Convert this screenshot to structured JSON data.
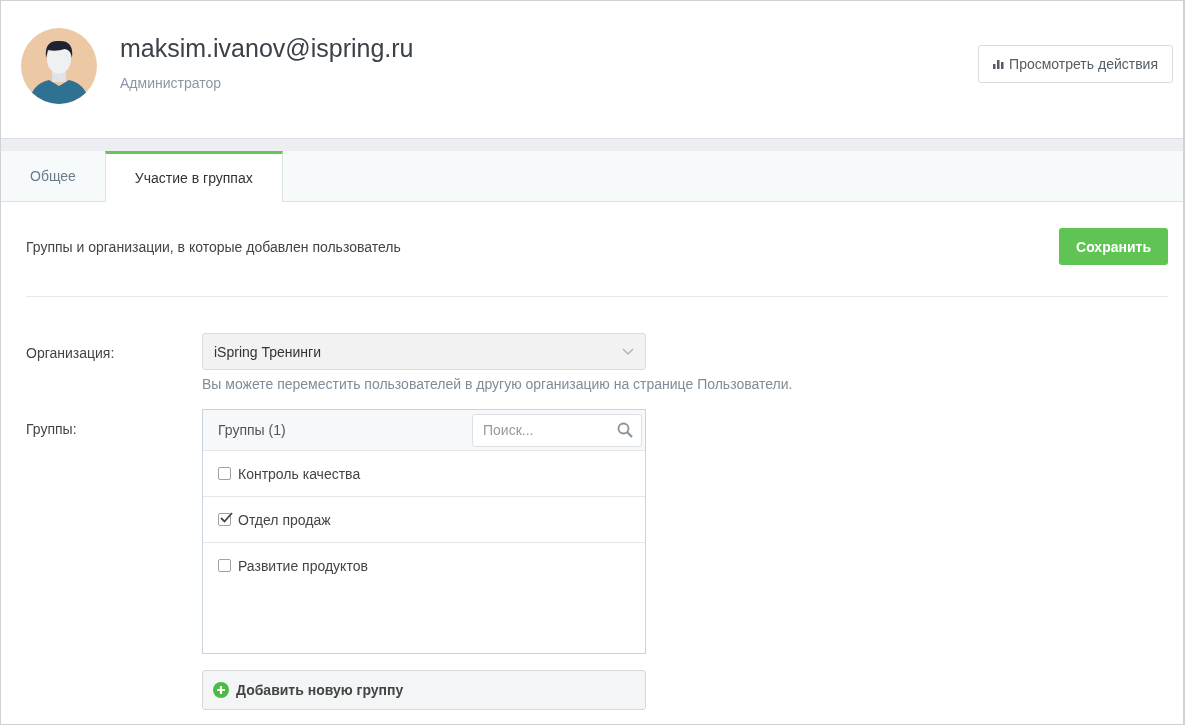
{
  "user": {
    "email": "maksim.ivanov@ispring.ru",
    "role": "Администратор"
  },
  "actions_button": {
    "label": "Просмотреть действия"
  },
  "tabs": [
    {
      "label": "Общее",
      "selected": false
    },
    {
      "label": "Участие в группах",
      "selected": true
    }
  ],
  "description": "Группы и организации, в которые добавлен пользователь",
  "save_button": {
    "label": "Сохранить"
  },
  "organization": {
    "label": "Организация:",
    "value": "iSpring Тренинги",
    "hint": "Вы можете переместить пользователей в другую организацию на странице Пользователи."
  },
  "groups": {
    "label": "Группы:",
    "title": "Группы (1)",
    "search": {
      "placeholder": "Поиск..."
    },
    "items": [
      {
        "label": "Контроль качества",
        "checked": false
      },
      {
        "label": "Отдел продаж",
        "checked": true
      },
      {
        "label": "Развитие продуктов",
        "checked": false
      }
    ]
  },
  "add_group_button": {
    "label": "Добавить новую группу"
  }
}
